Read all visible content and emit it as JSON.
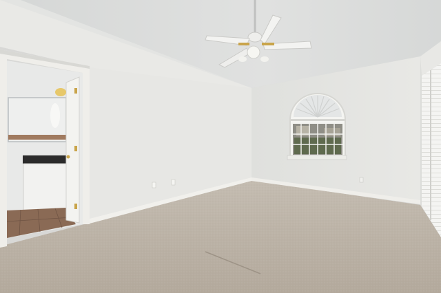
{
  "scene": {
    "subject": "empty-bedroom-interior",
    "elements": [
      "vaulted-ceiling",
      "ceiling-fan",
      "arched-window",
      "bathroom-doorway",
      "carpet-floor",
      "sliding-door-blinds"
    ]
  },
  "colors": {
    "ceiling": "#dcdedd",
    "wall_left": "#e6e6e3",
    "wall_back": "#e2e3e0",
    "wall_right": "#d9dad7",
    "carpet": "#bdb4a8",
    "baseboard": "#f0efeb",
    "door_trim": "#ecebe7",
    "bath_tile": "#8a6a55",
    "counter": "#2b2b2b",
    "fan_brass": "#c9a44a"
  }
}
